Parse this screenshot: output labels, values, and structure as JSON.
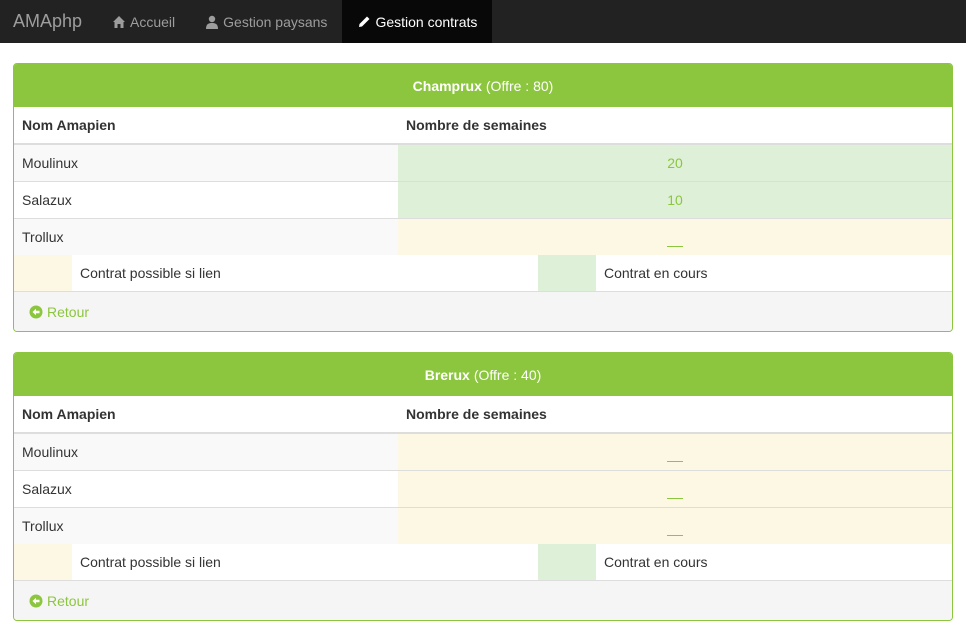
{
  "navbar": {
    "brand": "AMAphp",
    "items": [
      {
        "label": "Accueil",
        "icon": "home-icon"
      },
      {
        "label": "Gestion paysans",
        "icon": "user-icon"
      },
      {
        "label": "Gestion contrats",
        "icon": "pencil-icon",
        "active": true
      }
    ]
  },
  "columns": {
    "name": "Nom Amapien",
    "weeks": "Nombre de semaines"
  },
  "legend": {
    "possible": "Contrat possible si lien",
    "current": "Contrat en cours"
  },
  "footer": {
    "back_label": "Retour"
  },
  "colors": {
    "accent": "#8cc63e",
    "success": "#dff0d8",
    "warning": "#fcf8e3",
    "navbar": "#222222"
  },
  "panels": [
    {
      "farm": "Champrux",
      "offer": "(Offre : 80)",
      "rows": [
        {
          "name": "Moulinux",
          "weeks": "20",
          "status": "success"
        },
        {
          "name": "Salazux",
          "weeks": "10",
          "status": "success"
        },
        {
          "name": "Trollux",
          "weeks": "",
          "status": "warning"
        }
      ]
    },
    {
      "farm": "Brerux",
      "offer": "(Offre : 40)",
      "rows": [
        {
          "name": "Moulinux",
          "weeks": "",
          "status": "warning"
        },
        {
          "name": "Salazux",
          "weeks": "",
          "status": "warning"
        },
        {
          "name": "Trollux",
          "weeks": "",
          "status": "warning"
        }
      ]
    }
  ]
}
